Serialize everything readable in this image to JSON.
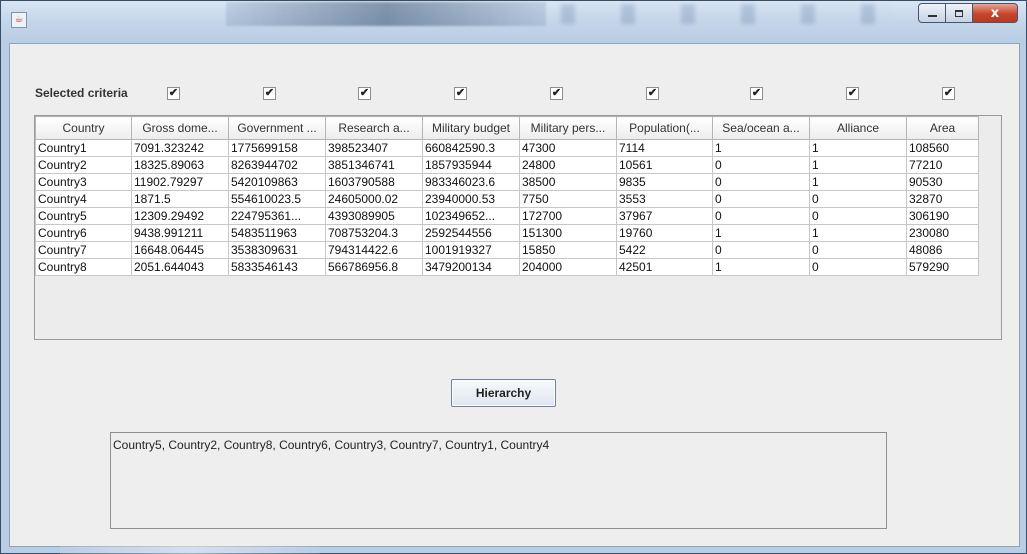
{
  "window": {
    "title": "",
    "minimize_label": "",
    "maximize_label": "",
    "close_label": "x"
  },
  "criteria": {
    "label": "Selected criteria",
    "checkboxes": [
      true,
      true,
      true,
      true,
      true,
      true,
      true,
      true,
      true
    ],
    "check_glyph": "✔"
  },
  "table": {
    "columns": [
      "Country",
      "Gross dome...",
      "Government ...",
      "Research a...",
      "Military budget",
      "Military pers...",
      "Population(...",
      "Sea/ocean a...",
      "Alliance",
      "Area"
    ],
    "rows": [
      [
        "Country1",
        "7091.323242",
        "1775699158",
        "398523407",
        "660842590.3",
        "47300",
        "7114",
        "1",
        "1",
        "108560"
      ],
      [
        "Country2",
        "18325.89063",
        "8263944702",
        "3851346741",
        "1857935944",
        "24800",
        "10561",
        "0",
        "1",
        "77210"
      ],
      [
        "Country3",
        "11902.79297",
        "5420109863",
        "1603790588",
        "983346023.6",
        "38500",
        "9835",
        "0",
        "1",
        "90530"
      ],
      [
        "Country4",
        "1871.5",
        "554610023.5",
        "24605000.02",
        "23940000.53",
        "7750",
        "3553",
        "0",
        "0",
        "32870"
      ],
      [
        "Country5",
        "12309.29492",
        "224795361...",
        "4393089905",
        "102349652...",
        "172700",
        "37967",
        "0",
        "0",
        "306190"
      ],
      [
        "Country6",
        "9438.991211",
        "5483511963",
        "708753204.3",
        "2592544556",
        "151300",
        "19760",
        "1",
        "1",
        "230080"
      ],
      [
        "Country7",
        "16648.06445",
        "3538309631",
        "794314422.6",
        "1001919327",
        "15850",
        "5422",
        "0",
        "0",
        "48086"
      ],
      [
        "Country8",
        "2051.644043",
        "5833546143",
        "566786956.8",
        "3479200134",
        "204000",
        "42501",
        "1",
        "0",
        "579290"
      ]
    ]
  },
  "hierarchy_button": {
    "label": "Hierarchy"
  },
  "result": {
    "text": "Country5, Country2, Country8, Country6, Country3, Country7, Country1, Country4"
  }
}
